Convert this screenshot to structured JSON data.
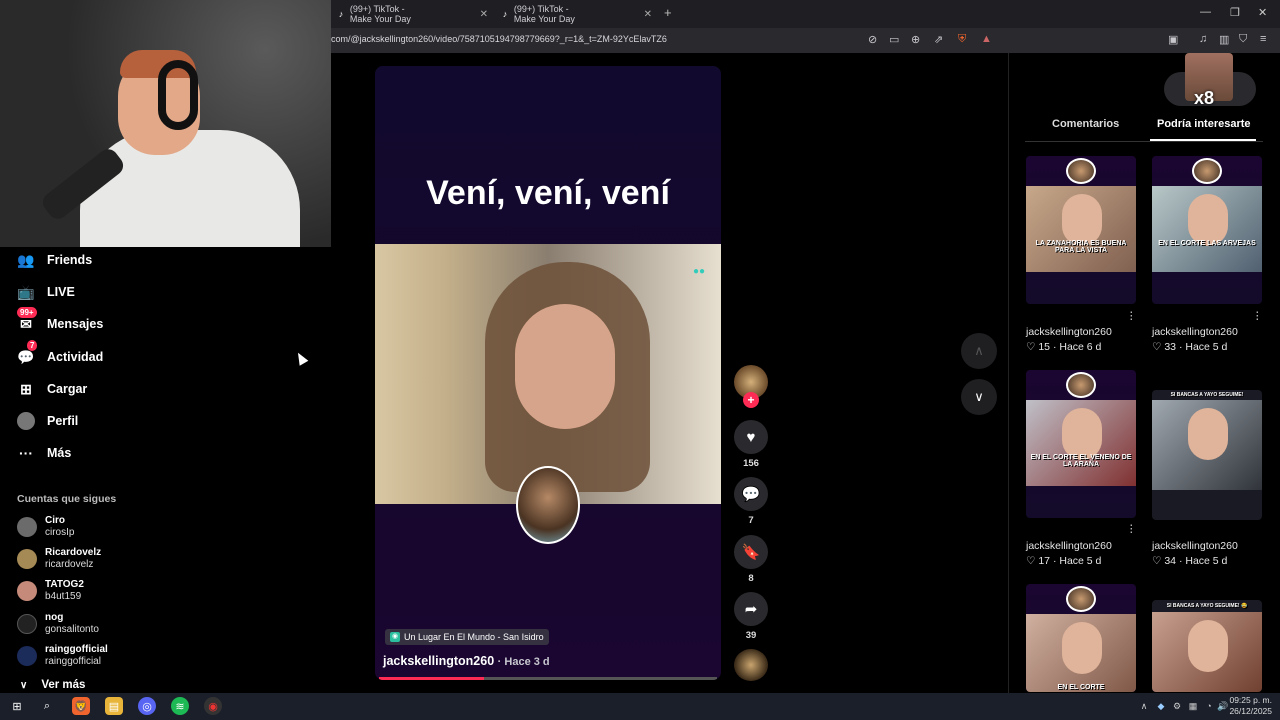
{
  "browser": {
    "tabs": [
      {
        "label": "(99+) TikTok - Make Your Day"
      },
      {
        "label": "(99+) TikTok - Make Your Day"
      }
    ],
    "new_tab": "+",
    "url": "com/@jackskellington260/video/7587105194798779669?_r=1&_t=ZM-92YcElavTZ6"
  },
  "sidebar": {
    "items": [
      {
        "label": "Friends",
        "icon": "friends-icon"
      },
      {
        "label": "LIVE",
        "icon": "live-icon"
      },
      {
        "label": "Mensajes",
        "icon": "messages-icon",
        "badge": "99+"
      },
      {
        "label": "Actividad",
        "icon": "activity-icon",
        "badge": "7"
      },
      {
        "label": "Cargar",
        "icon": "upload-icon"
      },
      {
        "label": "Perfil",
        "icon": "profile-icon"
      },
      {
        "label": "Más",
        "icon": "more-icon"
      }
    ],
    "following_title": "Cuentas que sigues",
    "following": [
      {
        "name": "Ciro",
        "handle": "cirosIp"
      },
      {
        "name": "Ricardovelz",
        "handle": "ricardovelz"
      },
      {
        "name": "TATOG2",
        "handle": "b4ut159"
      },
      {
        "name": "nog",
        "handle": "gonsalitonto"
      },
      {
        "name": "rainggofficial",
        "handle": "rainggofficial"
      }
    ],
    "see_more": "Ver más"
  },
  "video": {
    "caption_overlay": "Vení, vení, vení",
    "location": "Un Lugar En El Mundo - San Isidro",
    "author": "jackskellington260",
    "time_ago": "Hace 3 d",
    "progress_fraction": 0.31
  },
  "actions": {
    "likes": "156",
    "comments": "7",
    "saves": "8",
    "shares": "39"
  },
  "right_panel": {
    "reaction_count": "x8",
    "tabs": [
      "Comentarios",
      "Podría interesarte"
    ],
    "thumbs": [
      {
        "caption": "LA ZANAHORIA ES BUENA PARA LA VISTA",
        "user": "jackskellington260",
        "likes": "15",
        "time": "Hace 6 d"
      },
      {
        "caption": "EN EL CORTE LAS ARVEJAS",
        "user": "jackskellington260",
        "likes": "33",
        "time": "Hace 5 d"
      },
      {
        "caption": "EN EL CORTE EL VENENO DE LA ARAÑA",
        "user": "jackskellington260",
        "likes": "17",
        "time": "Hace 5 d"
      },
      {
        "caption": "SI BANCAS A YAYO SEGUIME!",
        "user": "jackskellington260",
        "likes": "34",
        "time": "Hace 5 d"
      },
      {
        "caption": "EN EL CORTE",
        "user": "",
        "likes": "",
        "time": ""
      },
      {
        "caption": "SI BANCAS A YAYO SEGUIME! 😂",
        "user": "",
        "likes": "",
        "time": ""
      }
    ]
  },
  "taskbar": {
    "time": "09:25 p. m.",
    "date": "26/12/2025"
  },
  "colors": {
    "accent": "#fe2c55",
    "video_bg": "#14072c"
  }
}
